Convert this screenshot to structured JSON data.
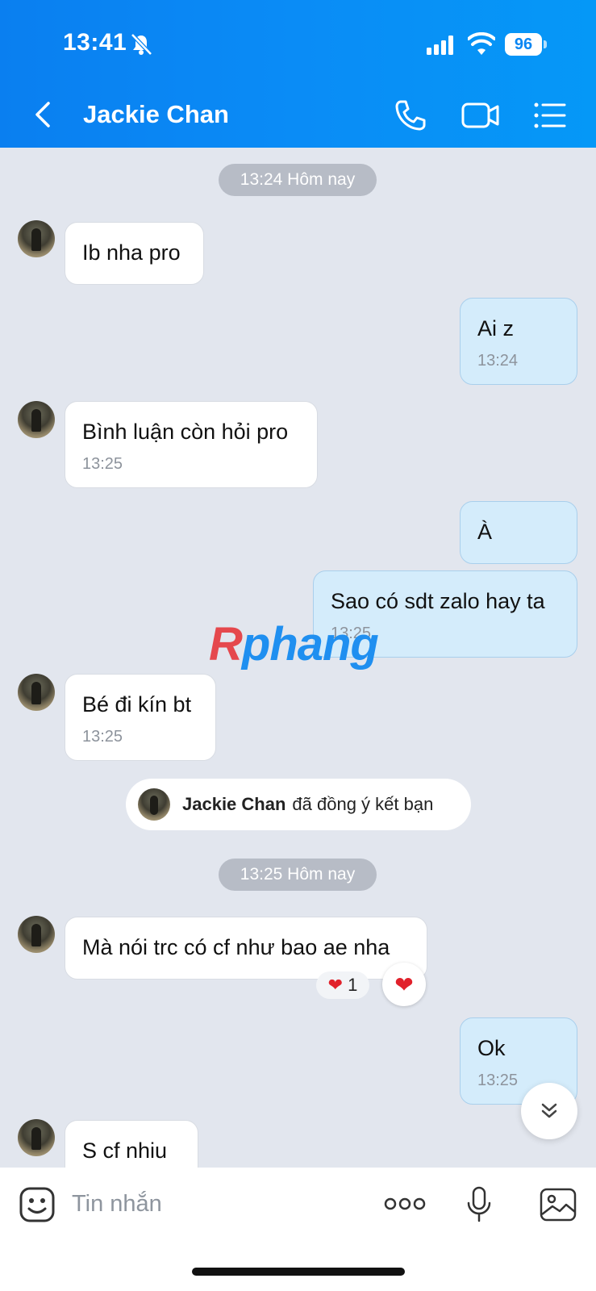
{
  "status_bar": {
    "time": "13:41",
    "battery": "96"
  },
  "header": {
    "contact_name": "Jackie Chan"
  },
  "dates": [
    "13:24 Hôm nay",
    "13:25 Hôm nay"
  ],
  "messages": [
    {
      "text": "Ib nha pro",
      "time": ""
    },
    {
      "text": "Ai z",
      "time": "13:24"
    },
    {
      "text": "Bình luận còn hỏi pro",
      "time": "13:25"
    },
    {
      "text": "À",
      "time": ""
    },
    {
      "text": "Sao có sdt zalo hay ta",
      "time": "13:25"
    },
    {
      "text": "Bé đi kín bt",
      "time": "13:25"
    },
    {
      "text": "Mà nói trc có cf như bao ae nha",
      "time": ""
    },
    {
      "text": "Ok",
      "time": "13:25"
    },
    {
      "text": "S cf nhiu",
      "time": ""
    }
  ],
  "system_message": {
    "name": "Jackie Chan",
    "text": "đã đồng ý kết bạn"
  },
  "reaction": {
    "count": "1",
    "icon": "heart-icon",
    "color": "#e1212b"
  },
  "watermark": {
    "part1": "R",
    "part2": "phang"
  },
  "input": {
    "placeholder": "Tin nhắn"
  },
  "colors": {
    "header": "#0a86f3",
    "incoming_bubble": "#ffffff",
    "outgoing_bubble": "#d4ecfb",
    "background": "#e2e6ee"
  }
}
